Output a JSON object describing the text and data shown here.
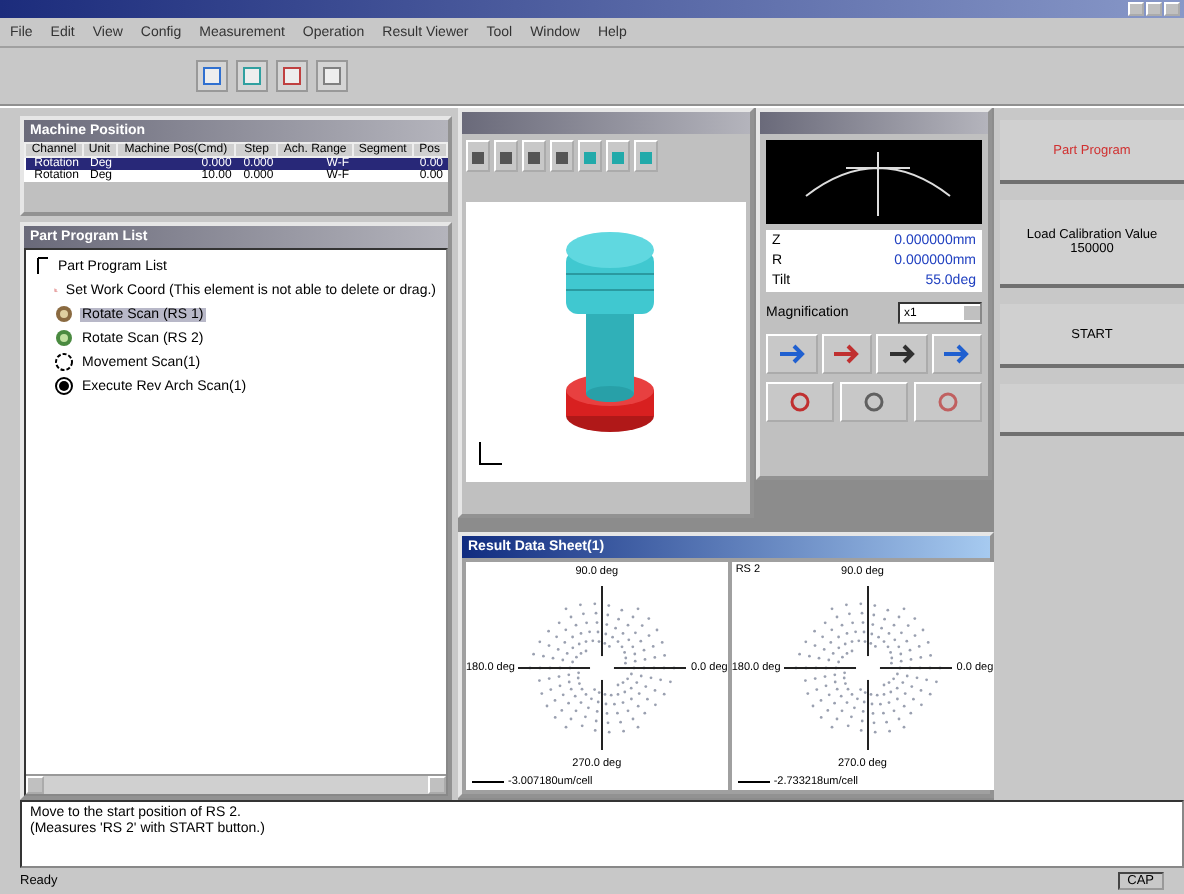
{
  "menu": [
    "File",
    "Edit",
    "View",
    "Config",
    "Measurement",
    "Operation",
    "Result Viewer",
    "Tool",
    "Window",
    "Help"
  ],
  "machine_position": {
    "title": "Machine Position",
    "columns": [
      "Channel",
      "Unit",
      "Machine Pos(Cmd)",
      "Step",
      "Ach. Range",
      "Segment",
      "Pos"
    ],
    "rows": [
      {
        "cells": [
          "Rotation",
          "Deg",
          "0.000",
          "0.000",
          "W-F",
          "",
          "0.00"
        ],
        "selected": true
      },
      {
        "cells": [
          "Rotation",
          "Deg",
          "10.00",
          "0.000",
          "W-F",
          "",
          "0.00"
        ],
        "selected": false
      }
    ]
  },
  "part_program_list": {
    "title": "Part Program List",
    "root": "Part Program List",
    "items": [
      {
        "label": "Set Work Coord (This element is not able to delete or drag.)",
        "kind": "coord",
        "selected": false
      },
      {
        "label": "Rotate Scan (RS 1)",
        "kind": "rotate",
        "selected": true
      },
      {
        "label": "Rotate Scan (RS 2)",
        "kind": "rotate2",
        "selected": false
      },
      {
        "label": "Movement Scan(1)",
        "kind": "movement",
        "selected": false
      },
      {
        "label": "Execute Rev Arch Scan(1)",
        "kind": "execute",
        "selected": false
      }
    ]
  },
  "position_panel": {
    "readouts": [
      {
        "label": "Z",
        "value": "0.000000mm"
      },
      {
        "label": "R",
        "value": "0.000000mm"
      },
      {
        "label": "Tilt",
        "value": "55.0deg"
      }
    ],
    "magnification": {
      "label": "Magnification",
      "value": "x1"
    }
  },
  "side_buttons": [
    {
      "label": "Part Program",
      "kind": "program"
    },
    {
      "label": "Load Calibration Value 150000",
      "kind": "calibration"
    },
    {
      "label": "START",
      "kind": "start"
    }
  ],
  "result_window": {
    "title": "Result Data Sheet(1)",
    "plots": [
      {
        "top": "90.0 deg",
        "left": "180.0 deg",
        "right": "0.0 deg",
        "bottom": "270.0 deg",
        "scale": "-3.007180um/cell"
      },
      {
        "caption": "RS 2",
        "top": "90.0 deg",
        "left": "180.0 deg",
        "right": "0.0 deg",
        "bottom": "270.0 deg",
        "scale": "-2.733218um/cell"
      }
    ]
  },
  "messages": [
    "Move to the start position of RS 2.",
    "(Measures 'RS 2' with START button.)"
  ],
  "status_bar": {
    "text": "Ready",
    "indicator": "CAP"
  }
}
